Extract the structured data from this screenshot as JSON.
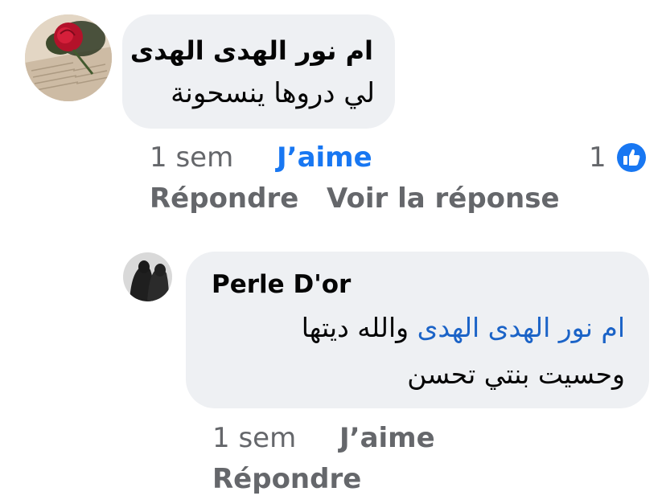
{
  "comment1": {
    "author": "ام نور الهدى الهدى",
    "text": "لي دروها ينسحونة",
    "time": "1 sem",
    "like_label": "J’aime",
    "reply_label": "Répondre",
    "view_reply_label": "Voir la réponse",
    "reaction_count": "1",
    "reaction_icon": "thumbs-up-icon",
    "accent_color": "#1877f2"
  },
  "reply1": {
    "author": "Perle D'or",
    "mention": "ام نور الهدى الهدى",
    "text_line1": "والله ديتها",
    "text_line2": "وحسيت بنتي تحسن",
    "time": "1 sem",
    "like_label": "J’aime",
    "reply_label": "Répondre"
  }
}
